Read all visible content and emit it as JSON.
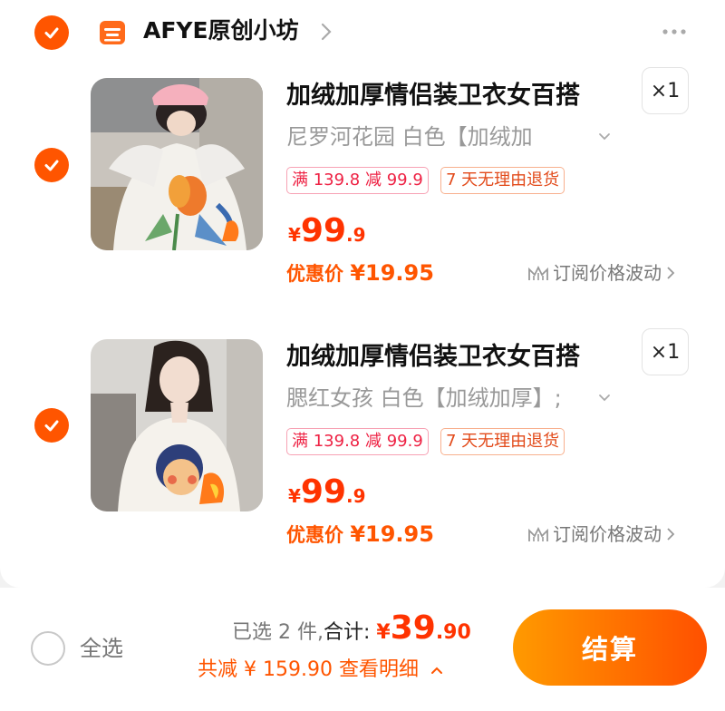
{
  "colors": {
    "accent": "#ff5500",
    "price": "#ff3300",
    "checkout_from": "#ff9a00",
    "checkout_to": "#ff5000"
  },
  "shop": {
    "name": "AFYE原创小坊",
    "icon": "shop-icon",
    "checked": true
  },
  "items": [
    {
      "title": "加绒加厚情侣装卫衣女百搭",
      "quantity": "×1",
      "spec": "尼罗河花园 白色【加绒加",
      "tag_discount": "满 139.8 减 99.9",
      "tag_return": "7 天无理由退货",
      "price_symbol": "¥",
      "price_int": "99",
      "price_dec": ".9",
      "promo_label": "优惠价",
      "promo_price": "¥19.95",
      "subscribe": "订阅价格波动",
      "checked": true
    },
    {
      "title": "加绒加厚情侣装卫衣女百搭",
      "quantity": "×1",
      "spec": "腮红女孩 白色【加绒加厚】;",
      "tag_discount": "满 139.8 减 99.9",
      "tag_return": "7 天无理由退货",
      "price_symbol": "¥",
      "price_int": "99",
      "price_dec": ".9",
      "promo_label": "优惠价",
      "promo_price": "¥19.95",
      "subscribe": "订阅价格波动",
      "checked": true
    }
  ],
  "footer": {
    "select_all": "全选",
    "selected_count": "已选 2 件,",
    "total_label": "合计:",
    "total_symbol": "¥",
    "total_int": "39",
    "total_dec": ".90",
    "savings": "共减 ¥ 159.90",
    "details": "查看明细",
    "checkout": "结算"
  }
}
